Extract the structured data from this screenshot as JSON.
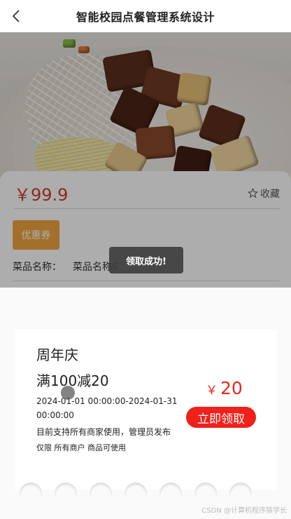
{
  "nav": {
    "title": "智能校园点餐管理系统设计"
  },
  "detail": {
    "price": "￥99.9",
    "favorite_label": "收藏",
    "coupon_button": "优惠券",
    "dish_label": "菜品名称：",
    "dish_value": "菜品名称6"
  },
  "toast": "领取成功!",
  "coupon": {
    "name": "周年庆",
    "rule": "满100减20",
    "time": "2024-01-01 00:00:00-2024-01-31 00:00:00",
    "description": "目前支持所有商家使用，管理员发布",
    "limit": "仅限 所有商户 商品可使用",
    "currency_symbol": "￥",
    "amount": "20",
    "claim_button": "立即领取"
  },
  "watermark": "CSDN @计算机程序猿学长",
  "icons": {
    "back": "back-arrow-icon",
    "favorite": "star-outline-icon"
  },
  "colors": {
    "price": "#d23b2b",
    "coupon_button": "#f0a540",
    "claim_button": "#f0201b",
    "amount": "#e8291c"
  }
}
